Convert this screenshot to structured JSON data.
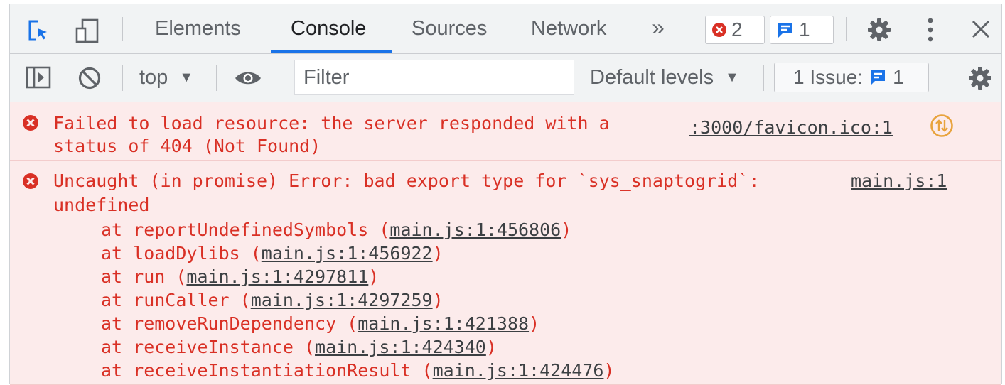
{
  "tabs": [
    {
      "label": "Elements"
    },
    {
      "label": "Console",
      "active": true
    },
    {
      "label": "Sources"
    },
    {
      "label": "Network"
    }
  ],
  "more_tabs": "»",
  "badges": {
    "errors": "2",
    "messages": "1"
  },
  "toolbar": {
    "context": "top",
    "filter_placeholder": "Filter",
    "levels": "Default levels",
    "issues_label": "1 Issue:",
    "issues_count": "1"
  },
  "messages": [
    {
      "line1": "Failed to load resource: the server responded with a",
      "line2": "status of 404 (Not Found)",
      "source": ":3000/favicon.ico:1"
    },
    {
      "line1": "Uncaught (in promise) Error: bad export type for `sys_snaptogrid`:",
      "line2": "undefined",
      "source": "main.js:1",
      "stack": [
        {
          "fn": "reportUndefinedSymbols",
          "loc": "main.js:1:456806"
        },
        {
          "fn": "loadDylibs",
          "loc": "main.js:1:456922"
        },
        {
          "fn": "run",
          "loc": "main.js:1:4297811"
        },
        {
          "fn": "runCaller",
          "loc": "main.js:1:4297259"
        },
        {
          "fn": "removeRunDependency",
          "loc": "main.js:1:421388"
        },
        {
          "fn": "receiveInstance",
          "loc": "main.js:1:424340"
        },
        {
          "fn": "receiveInstantiationResult",
          "loc": "main.js:1:424476"
        }
      ]
    }
  ],
  "colors": {
    "accent": "#1a73e8",
    "error": "#d93025",
    "error_bg": "#fcebeb",
    "warning": "#e8a33d"
  }
}
